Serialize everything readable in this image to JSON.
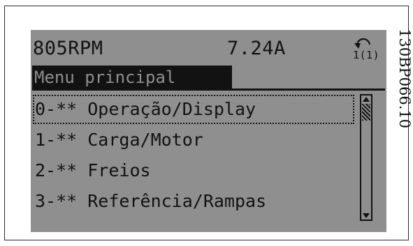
{
  "status": {
    "speed": "805RPM",
    "current": "7.24A",
    "setup_icon": "setup-cycle-icon",
    "setup_label": "1(1)"
  },
  "menu": {
    "title": "Menu principal",
    "selected_index": 0,
    "items": [
      {
        "label": "0-** Operação/Display"
      },
      {
        "label": "1-** Carga/Motor"
      },
      {
        "label": "2-** Freios"
      },
      {
        "label": "3-** Referência/Rampas"
      }
    ]
  },
  "figure_code": "130BP066.10",
  "colors": {
    "lcd_background": "#8f8f8f",
    "lcd_foreground": "#121212"
  }
}
